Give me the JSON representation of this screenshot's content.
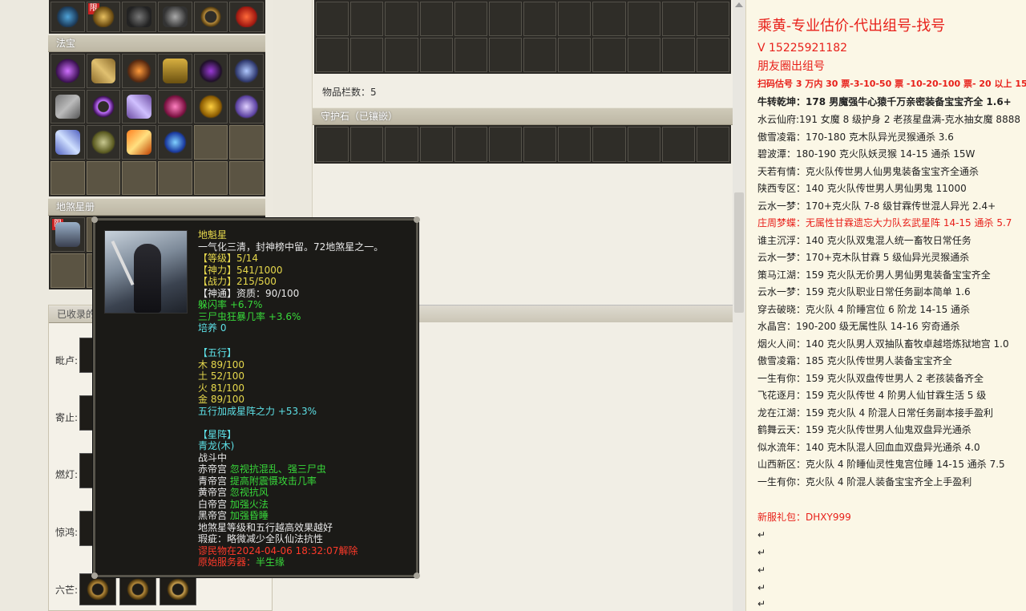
{
  "left_panel": {
    "fabao_title": "法宝",
    "disha_title": "地煞星册",
    "collected_title": "已收录的",
    "xian_badge": "限",
    "row_labels": [
      "毗卢:",
      "寄止:",
      "燃灯:",
      "惊鸿:",
      "六芒:"
    ]
  },
  "middle_panel": {
    "item_count_label": "物品栏数：5",
    "guardian_title": "守护石（已镶嵌）"
  },
  "tooltip": {
    "name": "地魁星",
    "desc": "一气化三清，封神榜中留。72地煞星之一。",
    "level": "【等级】5/14",
    "power": "【神力】541/1000",
    "combat": "【战力】215/500",
    "aptitude": "【神通】资质：90/100",
    "dodge": "躲闪率 +6.7%",
    "crit": "三尸虫狂暴几率 +3.6%",
    "cultivate": "培养 0",
    "wuxing_title": "【五行】",
    "wuxing": [
      "木 89/100",
      "土 52/100",
      "火 81/100",
      "金 89/100"
    ],
    "wuxing_bonus": "五行加成星阵之力 +53.3%",
    "star_title": "【星阵】",
    "star_name": "青龙(木)",
    "star_status": "战斗中",
    "palaces": [
      {
        "name": "赤帝宫",
        "effect": "忽视抗混乱、强三尸虫"
      },
      {
        "name": "青帝宫",
        "effect": "提高附震慑攻击几率"
      },
      {
        "name": "黄帝宫",
        "effect": "忽视抗风"
      },
      {
        "name": "白帝宫",
        "effect": "加强火法"
      },
      {
        "name": "黑帝宫",
        "effect": "加强昏睡"
      }
    ],
    "note1": "地煞星等级和五行越高效果越好",
    "flaw": "瑕疵：略微减少全队仙法抗性",
    "bind": "谬民物在2024-04-06 18:32:07解除",
    "server_label": "原始服务器：",
    "server": "半生缘"
  },
  "right_panel": {
    "title": "乘黄-专业估价-代出组号-找号",
    "contact": "V   15225921182",
    "line2": "朋友圈出组号",
    "price_line": "扫码估号 3 万内 30 票-3-10-50 票  -10-20-100 票- 20 以上 150",
    "listings": [
      "牛转乾坤：178 男魔强牛心猿千万亲密装备宝宝齐全 1.6+",
      "水云仙府:191 女魔 8 级护身 2 老孩星盘满-克水抽女魔 8888",
      "傲雪凌霜：170-180 克木队异光灵猴通杀 3.6",
      "碧波潭：180-190 克火队妖灵猴 14-15 通杀 15W",
      "天若有情：克火队传世男人仙男鬼装备宝宝齐全通杀",
      "陕西专区：140 克火队传世男人男仙男鬼 11000",
      "云水一梦：170+克火队 7-8 级甘霖传世混人异光 2.4+",
      "庄周梦蝶：无属性甘霖遗忘大力队玄武星阵 14-15 通杀 5.7",
      "谁主沉浮：140 克火队双鬼混人统一畜牧日常任务",
      "云水一梦：170+克木队甘霖 5 级仙异光灵猴通杀",
      "策马江湖：159 克火队无价男人男仙男鬼装备宝宝齐全",
      "云水一梦：159 克火队职业日常任务副本简单 1.6",
      "穿去破晓：克火队 4 阶睡宫位 6 阶龙 14-15 通杀",
      "水晶宫：190-200 级无属性队 14-16 穷奇通杀",
      "烟火人间：140 克火队男人双抽队畜牧卓越塔炼狱地宫 1.0",
      "傲雪凌霜：185 克火队传世男人装备宝宝齐全",
      "一生有你：159 克火队双盘传世男人 2 老孩装备齐全",
      "飞花逐月：159 克火队传世 4 阶男人仙甘霖生活 5 级",
      "龙在江湖：159 克火队 4 阶混人日常任务副本接手盈利",
      "鹤舞云天：159 克火队传世男人仙鬼双盘异光通杀",
      "似水流年：140 克木队混人回血血双盘异光通杀 4.0",
      "山西新区：克火队 4 阶睡仙灵性鬼宫位睡 14-15 通杀 7.5",
      "一生有你：克火队 4 阶混人装备宝宝齐全上手盈利"
    ],
    "gift": "新服礼包：DHXY999",
    "para_mark": "↵"
  },
  "colors": {
    "accent_red": "#e8201a",
    "tooltip_yellow": "#e6d84c",
    "tooltip_green": "#38d93a",
    "tooltip_cyan": "#5de0e6"
  }
}
